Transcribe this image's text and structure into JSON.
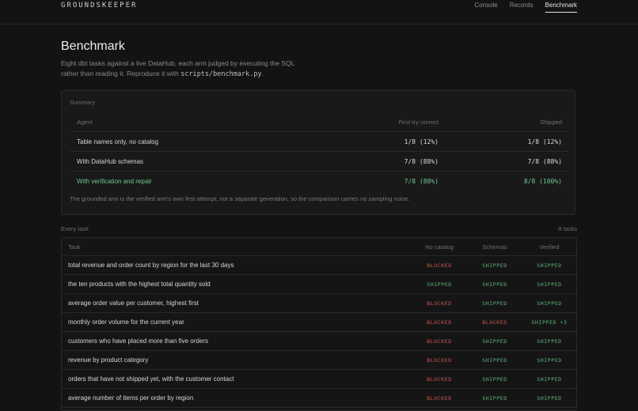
{
  "brand": "GROUNDSKEEPER",
  "nav": [
    {
      "label": "Console",
      "active": false
    },
    {
      "label": "Records",
      "active": false
    },
    {
      "label": "Benchmark",
      "active": true
    }
  ],
  "page": {
    "title": "Benchmark",
    "intro_text": "Eight dbt tasks against a live DataHub, each arm judged by executing the SQL rather than reading it. Reproduce it with ",
    "intro_code": "scripts/benchmark.py",
    "intro_end": "."
  },
  "summary": {
    "label": "Summary",
    "headers": {
      "agent": "Agent",
      "first_try": "First-try correct",
      "shipped": "Shipped"
    },
    "rows": [
      {
        "agent": "Table names only, no catalog",
        "first_try": "1/8 (12%)",
        "shipped": "1/8 (12%)",
        "highlight": false
      },
      {
        "agent": "With DataHub schemas",
        "first_try": "7/8 (88%)",
        "shipped": "7/8 (88%)",
        "highlight": false
      },
      {
        "agent": "With verification and repair",
        "first_try": "7/8 (88%)",
        "shipped": "8/8 (100%)",
        "highlight": true
      }
    ],
    "footnote": "The grounded arm is the verified arm's own first attempt, not a separate generation, so the comparison carries no sampling noise."
  },
  "tasks": {
    "label": "Every task",
    "count": "8 tasks",
    "headers": {
      "task": "Task",
      "no_catalog": "No catalog",
      "schemas": "Schemas",
      "verified": "Verified"
    },
    "rows": [
      {
        "task": "total revenue and order count by region for the last 30 days",
        "no_catalog": "BLOCKED",
        "schemas": "SHIPPED",
        "verified": "SHIPPED"
      },
      {
        "task": "the ten products with the highest total quantity sold",
        "no_catalog": "SHIPPED",
        "schemas": "SHIPPED",
        "verified": "SHIPPED"
      },
      {
        "task": "average order value per customer, highest first",
        "no_catalog": "BLOCKED",
        "schemas": "SHIPPED",
        "verified": "SHIPPED"
      },
      {
        "task": "monthly order volume for the current year",
        "no_catalog": "BLOCKED",
        "schemas": "BLOCKED",
        "verified": "SHIPPED +3"
      },
      {
        "task": "customers who have placed more than five orders",
        "no_catalog": "BLOCKED",
        "schemas": "SHIPPED",
        "verified": "SHIPPED"
      },
      {
        "task": "revenue by product category",
        "no_catalog": "BLOCKED",
        "schemas": "SHIPPED",
        "verified": "SHIPPED"
      },
      {
        "task": "orders that have not shipped yet, with the customer contact",
        "no_catalog": "BLOCKED",
        "schemas": "SHIPPED",
        "verified": "SHIPPED"
      },
      {
        "task": "average number of items per order by region",
        "no_catalog": "BLOCKED",
        "schemas": "SHIPPED",
        "verified": "SHIPPED"
      }
    ]
  },
  "colors": {
    "background": "#131314",
    "blocked": "#d0564f",
    "shipped": "#5fb57b",
    "highlight": "#6ec88d"
  }
}
